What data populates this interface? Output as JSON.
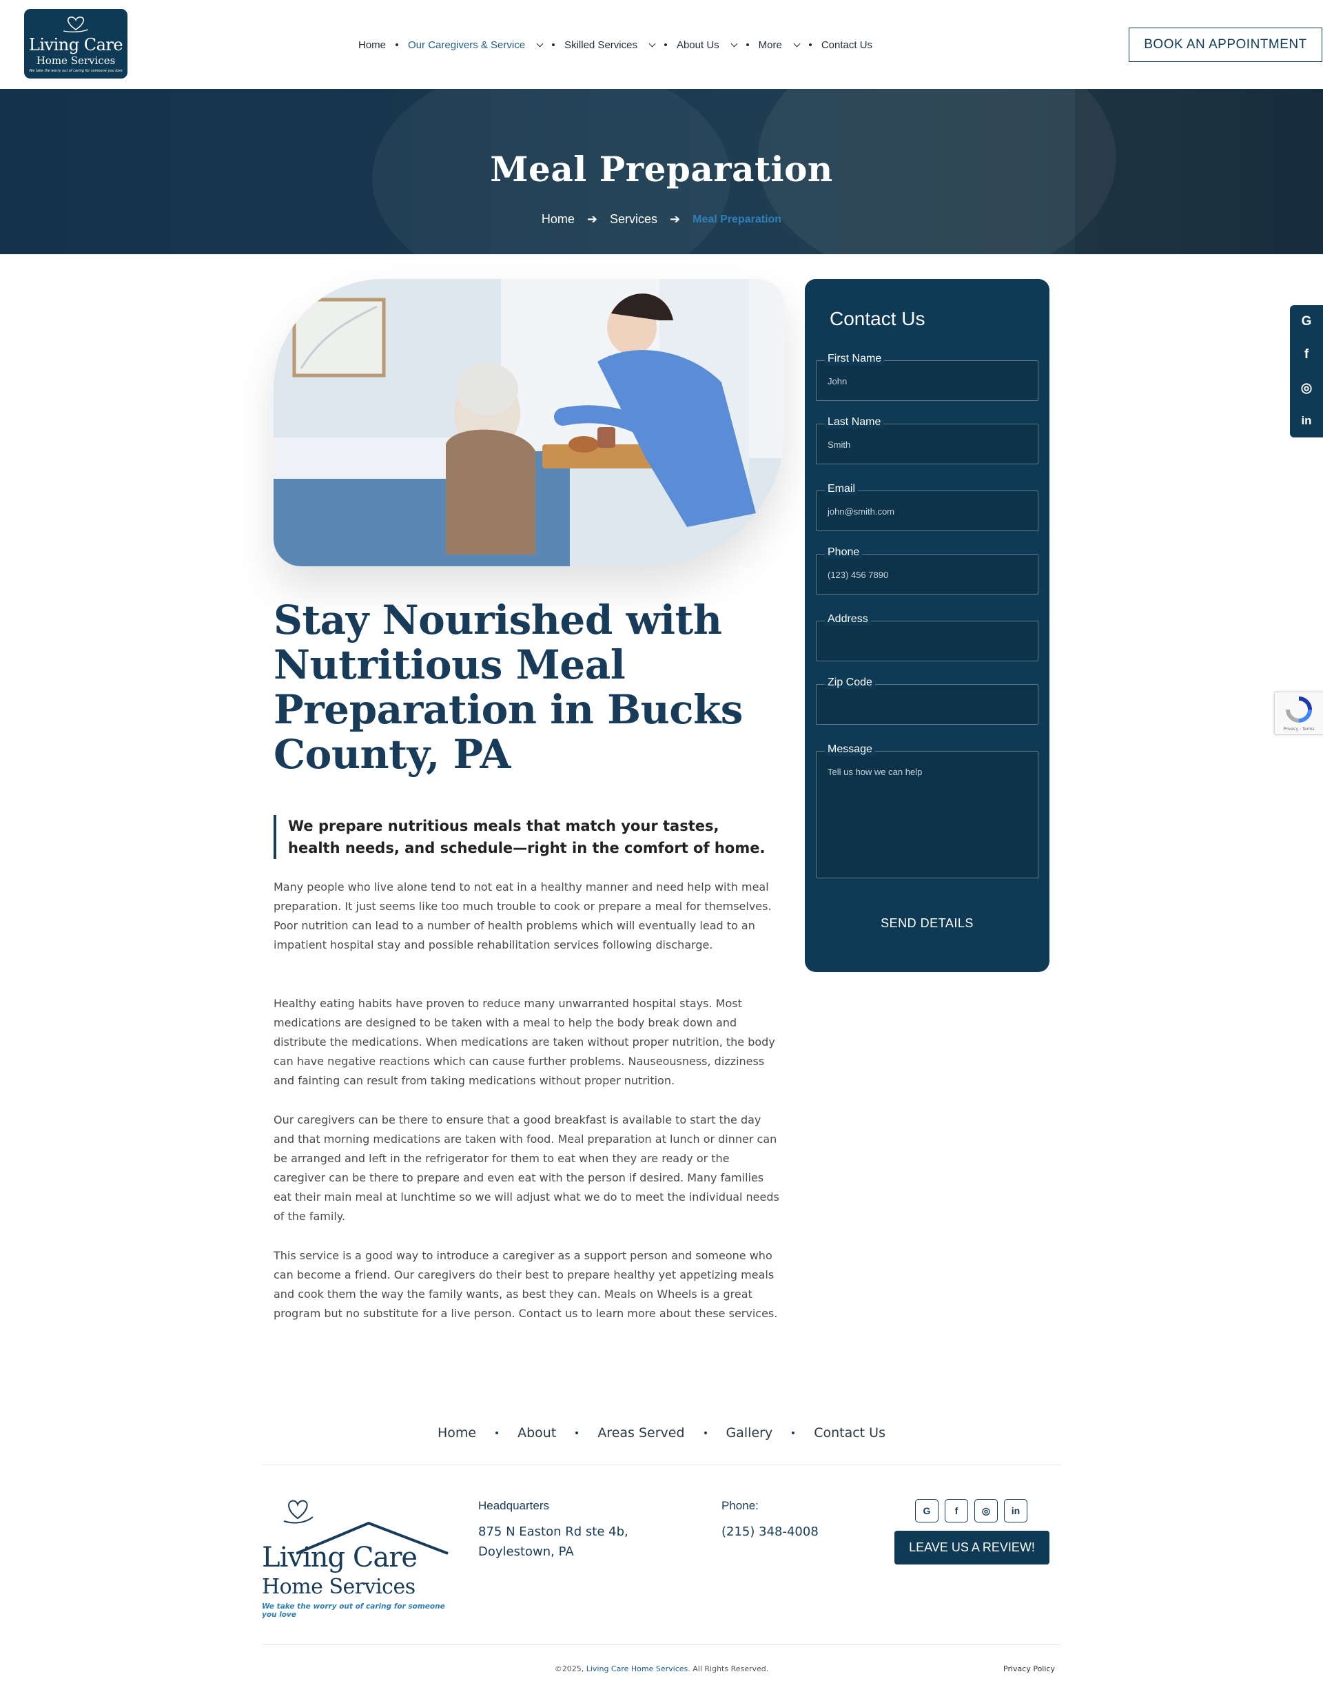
{
  "header": {
    "logo": {
      "line1": "Living Care",
      "line2": "Home Services",
      "tagline": "We take the worry out of caring for someone you love"
    },
    "nav": [
      {
        "label": "Home",
        "has_dropdown": false,
        "active": false
      },
      {
        "label": "Our Caregivers & Service",
        "has_dropdown": true,
        "active": true
      },
      {
        "label": "Skilled Services",
        "has_dropdown": true,
        "active": false
      },
      {
        "label": "About Us",
        "has_dropdown": true,
        "active": false
      },
      {
        "label": "More",
        "has_dropdown": true,
        "active": false
      },
      {
        "label": "Contact Us",
        "has_dropdown": false,
        "active": false
      }
    ],
    "book_button": "BOOK AN APPOINTMENT"
  },
  "hero": {
    "title": "Meal Preparation",
    "breadcrumb": [
      "Home",
      "Services",
      "Meal Preparation"
    ]
  },
  "article": {
    "title": "Stay Nourished with Nutritious Meal Preparation in Bucks County, PA",
    "quote": "We prepare nutritious meals that match your tastes, health needs, and schedule—right in the comfort of home.",
    "paragraphs": [
      "Many people who live alone tend to not eat in a healthy manner and need help with meal preparation. It just seems like too much trouble to cook or prepare a meal for themselves. Poor nutrition can lead to a number of health problems which will eventually lead to an impatient hospital stay and possible rehabilitation services following discharge.",
      "Healthy eating habits have proven to reduce many unwarranted hospital stays. Most medications are designed to be taken with a meal to help the body break down and distribute the medications. When medications are taken without proper nutrition, the body can have negative reactions which can cause further problems. Nauseousness, dizziness and fainting can result from taking medications without proper nutrition.",
      "Our caregivers can be there to ensure that a good breakfast is available to start the day and that morning medications are taken with food. Meal preparation at lunch or dinner can be arranged and left in the refrigerator for them to eat when they are ready or the caregiver can be there to prepare and even eat with the person if desired. Many families eat their main meal at lunchtime so we will adjust what we do to meet the individual needs of the family.",
      "This service is a good way to introduce a caregiver as a support person and someone who can become a friend. Our caregivers do their best to prepare healthy yet appetizing meals and cook them the way the family wants, as best they can. Meals on Wheels is a great program but no substitute for a live person. Contact us to learn more about these services."
    ]
  },
  "contact_form": {
    "title": "Contact Us",
    "fields": [
      {
        "label": "First Name",
        "placeholder": "John"
      },
      {
        "label": "Last Name",
        "placeholder": "Smith"
      },
      {
        "label": "Email",
        "placeholder": "john@smith.com"
      },
      {
        "label": "Phone",
        "placeholder": "(123) 456 7890"
      },
      {
        "label": "Address",
        "placeholder": ""
      },
      {
        "label": "Zip Code",
        "placeholder": ""
      },
      {
        "label": "Message",
        "placeholder": "Tell us how we can help"
      }
    ],
    "submit": "SEND DETAILS"
  },
  "floating_social": {
    "google": "G",
    "facebook": "f",
    "instagram": "◎",
    "linkedin": "in"
  },
  "recaptcha": {
    "text": "Privacy - Terms"
  },
  "footer": {
    "nav": [
      "Home",
      "About",
      "Areas Served",
      "Gallery",
      "Contact Us"
    ],
    "logo": {
      "line1": "Living Care",
      "line2": "Home Services",
      "tagline": "We take the worry out of caring for someone you love"
    },
    "headquarters": {
      "heading": "Headquarters",
      "line1": "875 N Easton Rd ste 4b,",
      "line2": "Doylestown, PA"
    },
    "phone": {
      "heading": "Phone:",
      "number": "(215) 348-4008"
    },
    "social": {
      "google": "G",
      "facebook": "f",
      "instagram": "◎",
      "linkedin": "in"
    },
    "review_button": "LEAVE US A REVIEW!",
    "copyright_prefix": "©2025,",
    "copyright_brand": "Living Care Home Services",
    "copyright_suffix": ". All Rights Reserved.",
    "privacy": "Privacy Policy"
  },
  "colors": {
    "navy": "#0f3a55",
    "title_navy": "#173b58",
    "accent_blue": "#2e7fb8"
  }
}
